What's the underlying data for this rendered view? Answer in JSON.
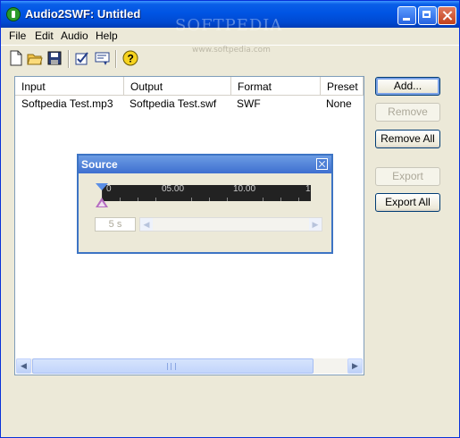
{
  "window": {
    "title": "Audio2SWF: Untitled",
    "watermark": "SOFTPEDIA",
    "watermark_url": "www.softpedia.com"
  },
  "menu": [
    "File",
    "Edit",
    "Audio",
    "Help"
  ],
  "toolbar": {
    "icons": [
      "new-file-icon",
      "open-folder-icon",
      "save-icon",
      "check-settings-icon",
      "preview-icon",
      "help-icon"
    ]
  },
  "list": {
    "columns": [
      "Input",
      "Output",
      "Format",
      "Preset"
    ],
    "rows": [
      {
        "input": "Softpedia Test.mp3",
        "output": "Softpedia Test.swf",
        "format": "SWF",
        "preset": "None"
      }
    ],
    "scroll_arrow_left": "◀",
    "scroll_arrow_right": "▶"
  },
  "buttons": {
    "add": "Add...",
    "remove": "Remove",
    "remove_all": "Remove All",
    "export": "Export",
    "export_all": "Export All"
  },
  "source_dialog": {
    "title": "Source",
    "ruler_labels": [
      "0",
      "05.00",
      "10.00",
      "1"
    ],
    "duration": "5 s",
    "scroll_arrow_left": "◀",
    "scroll_arrow_right": "▶"
  }
}
